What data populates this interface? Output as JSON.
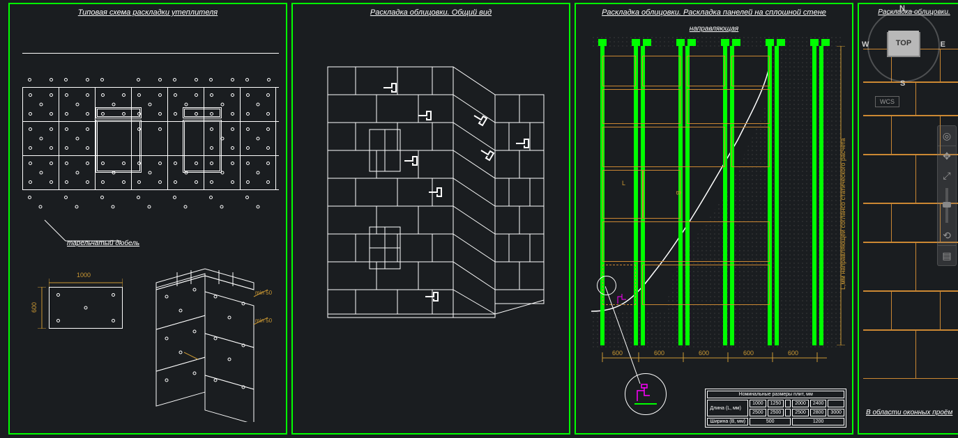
{
  "sheets": {
    "s1": {
      "title": "Типовая схема раскладки утеплителя",
      "label_dowel": "тарельчатый дюбель",
      "dim_1000": "1000",
      "dim_600": "600",
      "iso_min50a": "min 50",
      "iso_min50b": "min 50"
    },
    "s2": {
      "title": "Раскладка облицовки. Общий вид"
    },
    "s3": {
      "title": "Раскладка облицовки. Раскладка панелей на сплошной стене",
      "guide": "направляющая",
      "dim_600": "600",
      "dim_L": "L",
      "dim_B": "B",
      "dim_v": "L,мм направляющей соглансо статического расчета",
      "tbl_header": "Номинальные размеры плит, мм",
      "tbl_r1c1": "Длина (L, мм)",
      "tbl_r1_vals": [
        "1000",
        "1250",
        "",
        "2000",
        "2400",
        ""
      ],
      "tbl_r2_vals": [
        "2500",
        "2500",
        "",
        "2500",
        "2800",
        "3000"
      ],
      "tbl_r2c1": "Ширина (B, мм)",
      "tbl_wa": "500",
      "tbl_wb": "1200"
    },
    "s4": {
      "title": "Раскладка облицовки.",
      "sub": "В области оконных проём"
    }
  },
  "viewcube": {
    "top": "TOP",
    "n": "N",
    "s": "S",
    "e": "E",
    "w": "W",
    "wcs": "WCS"
  }
}
